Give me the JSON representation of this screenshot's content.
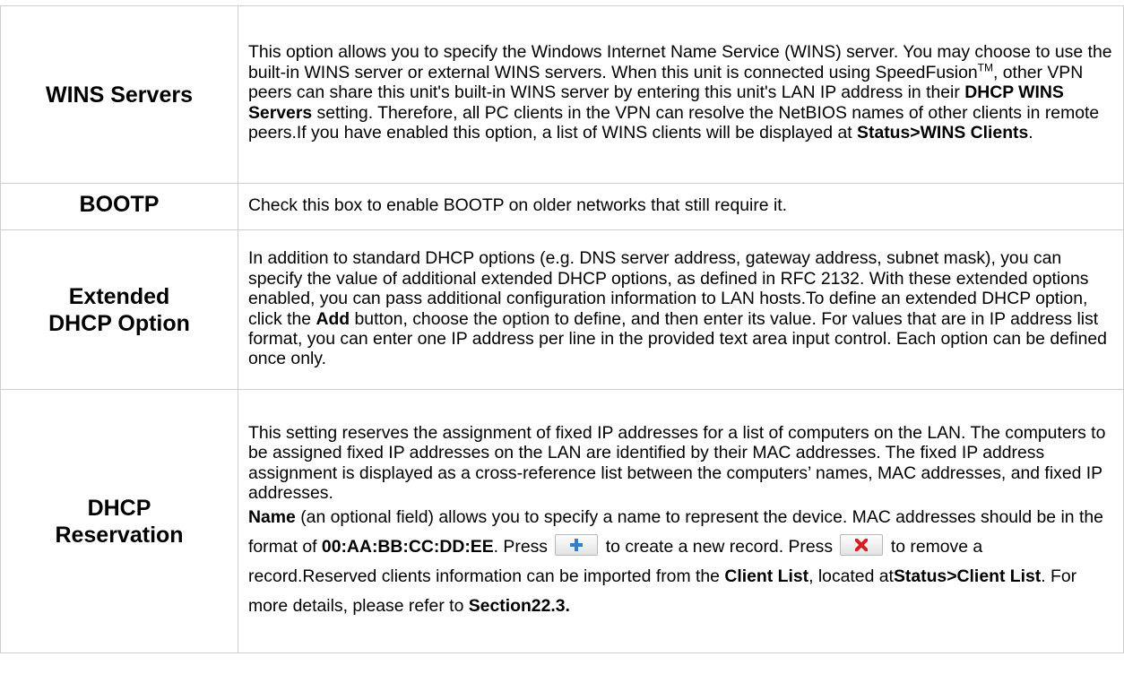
{
  "rows": [
    {
      "label": "WINS Servers",
      "text": {
        "p1": "This option allows you to specify the Windows Internet Name Service (WINS) server. You may choose to use the built-in WINS server or external WINS servers. When this unit is connected using SpeedFusion",
        "tm": "TM",
        "p2": ", other VPN peers can share this unit's built-in WINS server by entering this unit's LAN IP address in their ",
        "b1": "DHCP WINS Servers",
        "p3": " setting. Therefore, all PC clients in the VPN can resolve the NetBIOS names of other clients in remote peers.If you have enabled this option, a list of WINS clients will be displayed at ",
        "b2": "Status>WINS Clients",
        "p4": "."
      }
    },
    {
      "label": "BOOTP",
      "text": {
        "p1": "Check this box to enable BOOTP on older networks that still require it."
      }
    },
    {
      "label_line1": "Extended",
      "label_line2": "DHCP Option",
      "text": {
        "p1": "In addition to standard DHCP options (e.g. DNS server address, gateway address, subnet mask), you can specify the value of additional extended DHCP options, as defined in RFC 2132. With these extended options enabled, you can pass additional configuration information to LAN hosts.To define an extended DHCP option, click the ",
        "b1": "Add",
        "p2": " button, choose the option to define, and then enter its value. For values that are in IP address list format, you can enter one IP address per line in the provided text area input control. Each option can be defined once only."
      }
    },
    {
      "label_line1": "DHCP",
      "label_line2": "Reservation",
      "text": {
        "p1": "This setting reserves the assignment of fixed IP addresses for a list of computers on the LAN. The computers to be assigned fixed IP addresses on the LAN are identified by their MAC addresses. The fixed IP address assignment is displayed as a cross-reference list between the computers’ names, MAC addresses, and fixed IP addresses.",
        "b1": "Name",
        "p2": " (an optional field) allows you to specify a name to represent the device. MAC addresses should be in the format of ",
        "b2": "00:AA:BB:CC:DD:EE",
        "p3": ". Press ",
        "p4": " to create a new record. Press ",
        "p5": " to remove a record.Reserved clients information can be imported from the ",
        "b3": "Client List",
        "p6": ", located at",
        "b4": "Status>Client List",
        "p7": ". For more details, please refer to ",
        "b5": "Section22.3."
      },
      "add_icon": "plus-icon",
      "remove_icon": "x-icon",
      "add_icon_color": "#2f7fd0",
      "remove_icon_color": "#d42020"
    }
  ]
}
